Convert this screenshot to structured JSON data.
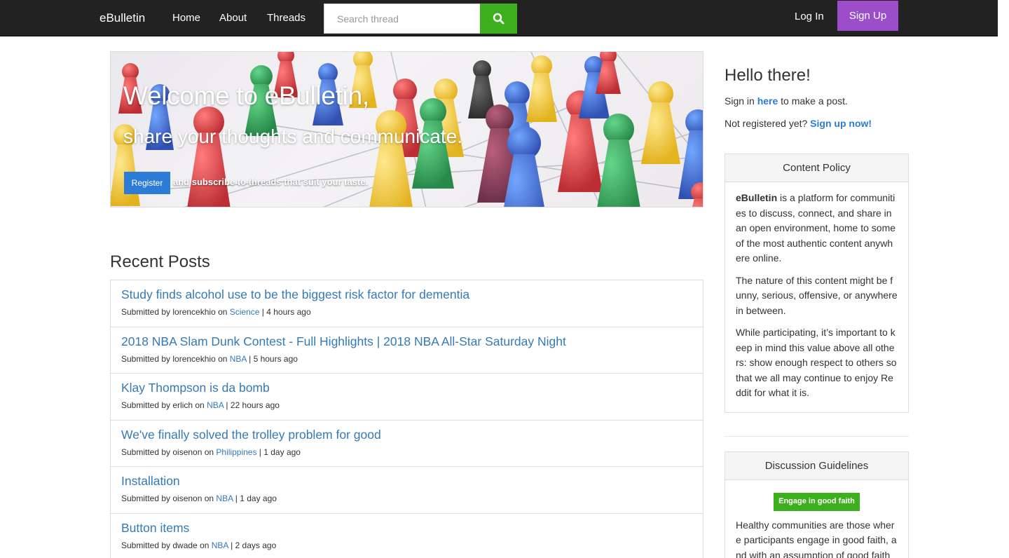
{
  "navbar": {
    "brand": "eBulletin",
    "links": [
      "Home",
      "About",
      "Threads"
    ],
    "search_placeholder": "Search thread",
    "login": "Log In",
    "signup": "Sign Up"
  },
  "hero": {
    "title": "Welcome to eBulletin,",
    "subtitle": "share your thoughts and communicate.",
    "register_button": "Register",
    "tagline": "and subscribe to threads that suit your taste."
  },
  "recent": {
    "heading": "Recent Posts",
    "posts": [
      {
        "title": "Study finds alcohol use to be the biggest risk factor for dementia",
        "prefix": "Submitted by lorencekhio on ",
        "thread": "Science",
        "time": " | 4 hours ago"
      },
      {
        "title": "2018 NBA Slam Dunk Contest - Full Highlights | 2018 NBA All-Star Saturday Night",
        "prefix": "Submitted by lorencekhio on ",
        "thread": "NBA",
        "time": " | 5 hours ago"
      },
      {
        "title": "Klay Thompson is da bomb",
        "prefix": "Submitted by erlich on ",
        "thread": "NBA",
        "time": " | 22 hours ago"
      },
      {
        "title": "We've finally solved the trolley problem for good",
        "prefix": "Submitted by oisenon on ",
        "thread": "Philippines",
        "time": " | 1 day ago"
      },
      {
        "title": "Installation",
        "prefix": "Submitted by oisenon on ",
        "thread": "NBA",
        "time": " | 1 day ago"
      },
      {
        "title": "Button items",
        "prefix": "Submitted by dwade on ",
        "thread": "NBA",
        "time": " | 2 days ago"
      }
    ]
  },
  "sidebar": {
    "hello": "Hello there!",
    "signin_pre": "Sign in ",
    "signin_link": "here",
    "signin_post": " to make a post.",
    "register_pre": "Not registered yet? ",
    "register_link": "Sign up now!",
    "content_policy": {
      "title": "Content Policy",
      "brand": "eBulletin",
      "p1_rest": " is a platform for communities to discuss, connect, and share in an open environment, home to some of the most authentic content anywhere online.",
      "p2": "The nature of this content might be funny, serious, offensive, or anywhere in between.",
      "p3": "While participating, it’s important to keep in mind this value above all others: show enough respect to others so that we all may continue to enjoy Reddit for what it is."
    },
    "guidelines": {
      "title": "Discussion Guidelines",
      "badge": "Engage in good faith",
      "text": "Healthy communities are those where participants engage in good faith, and with an assumption of good faith"
    }
  },
  "colors": {
    "navbar_bg": "#222222",
    "search_green": "#3cb01c",
    "signup_purple": "#9b4dca",
    "link_blue": "#337ab7",
    "register_blue": "#2c7bd6"
  },
  "icons": {
    "search": "search-icon"
  }
}
